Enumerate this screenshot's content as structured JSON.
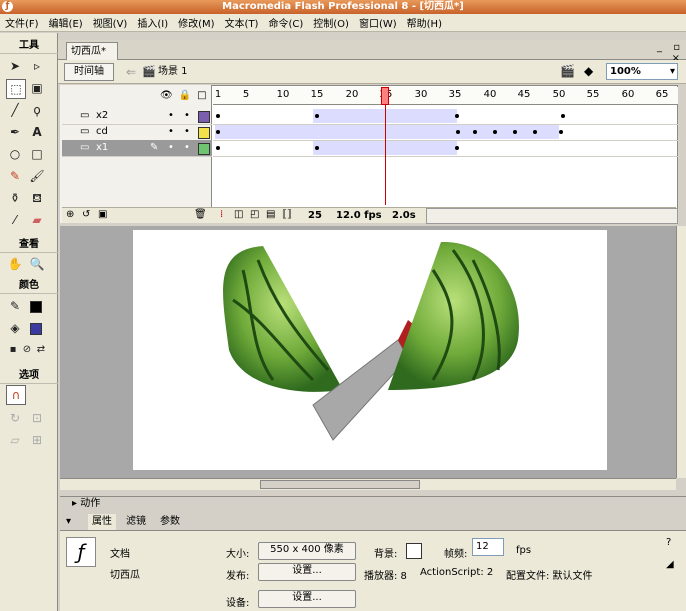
{
  "window": {
    "title": "Macromedia Flash Professional 8 - [切西瓜*]"
  },
  "menu": [
    "文件(F)",
    "编辑(E)",
    "视图(V)",
    "插入(I)",
    "修改(M)",
    "文本(T)",
    "命令(C)",
    "控制(O)",
    "窗口(W)",
    "帮助(H)"
  ],
  "tools": {
    "title": "工具",
    "view_title": "查看",
    "color_title": "颜色",
    "options_title": "选项",
    "stroke_color": "#000000",
    "fill_color": "#3a3aa0"
  },
  "document": {
    "tab_label": "切西瓜*",
    "window_controls": "_ ▫ ×"
  },
  "scene": {
    "timeline_button": "时间轴",
    "scene_label": "场景 1",
    "zoom": "100%"
  },
  "timeline": {
    "ruler_ticks": [
      "1",
      "5",
      "10",
      "15",
      "20",
      "25",
      "30",
      "35",
      "40",
      "45",
      "50",
      "55",
      "60",
      "65"
    ],
    "layers": [
      {
        "name": "x2",
        "color": "#7a5fae"
      },
      {
        "name": "cd",
        "color": "#f4e24a"
      },
      {
        "name": "x1",
        "color": "#6fc46f"
      }
    ],
    "current_frame": "25",
    "fps": "12.0 fps",
    "elapsed": "2.0s"
  },
  "panels": {
    "actions_label": "动作",
    "props_tabs": [
      "属性",
      "滤镜",
      "参数"
    ]
  },
  "properties": {
    "doc_label": "文档",
    "doc_name": "切西瓜",
    "size_label": "大小:",
    "size_value": "550 x 400 像素",
    "bg_label": "背景:",
    "fps_label": "帧频:",
    "fps_value": "12",
    "fps_unit": "fps",
    "publish_label": "发布:",
    "settings_button": "设置...",
    "player_label": "播放器: 8",
    "actionscript_label": "ActionScript: 2",
    "profile_label": "配置文件: 默认文件",
    "device_label": "设备:",
    "device_settings_button": "设置..."
  },
  "colors": {
    "stage_bg": "#ffffff",
    "accent": "#c8622a"
  }
}
